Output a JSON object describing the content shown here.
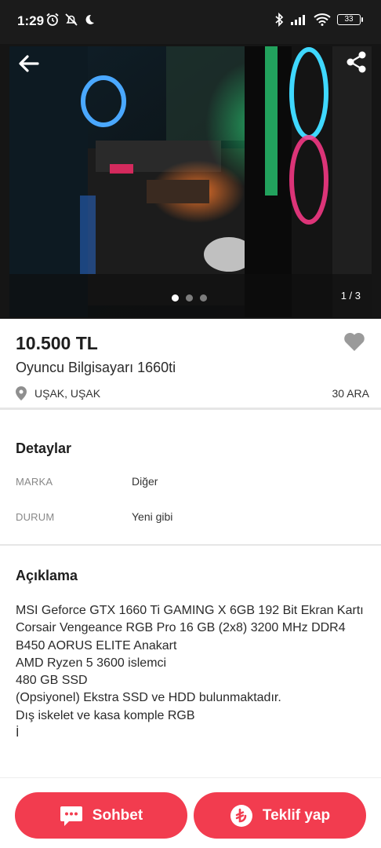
{
  "status_bar": {
    "time": "1:29",
    "battery": "33"
  },
  "gallery": {
    "counter": "1 / 3",
    "dots": 3,
    "active_dot": 0
  },
  "listing": {
    "price": "10.500 TL",
    "title": "Oyuncu Bilgisayarı 1660ti",
    "location": "UŞAK, UŞAK",
    "date": "30 ARA"
  },
  "details": {
    "heading": "Detaylar",
    "rows": [
      {
        "key": "MARKA",
        "value": "Diğer"
      },
      {
        "key": "DURUM",
        "value": "Yeni gibi"
      }
    ]
  },
  "description": {
    "heading": "Açıklama",
    "lines": [
      "MSI Geforce GTX 1660 Ti GAMING X 6GB 192 Bit Ekran Kartı",
      "Corsair Vengeance RGB Pro 16 GB (2x8) 3200 MHz DDR4",
      "B450 AORUS ELITE Anakart",
      "AMD Ryzen 5 3600 islemci",
      "480 GB SSD",
      "(Opsiyonel) Ekstra SSD ve HDD bulunmaktadır.",
      "Dış iskelet ve kasa komple RGB",
      "İ"
    ]
  },
  "actions": {
    "chat_label": "Sohbet",
    "offer_label": "Teklif yap"
  },
  "colors": {
    "accent": "#f23c4f",
    "status_bar": "#1b1b1b"
  }
}
